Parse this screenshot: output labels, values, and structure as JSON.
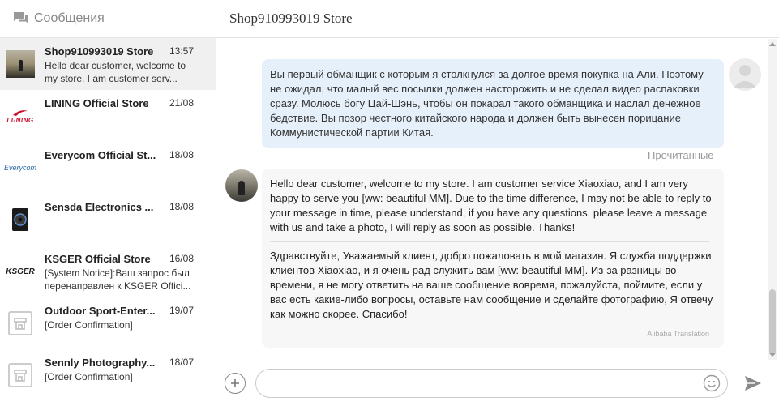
{
  "sidebar": {
    "title": "Сообщения",
    "conversations": [
      {
        "name": "Shop910993019 Store",
        "date": "13:57",
        "preview": "Hello dear customer, welcome to my store. I am customer serv...",
        "logo": "photo-avatar"
      },
      {
        "name": "LINING Official Store",
        "date": "21/08",
        "preview": "",
        "logo_text": "LI-NING"
      },
      {
        "name": "Everycom Official St...",
        "date": "18/08",
        "preview": "",
        "logo_text": "Everycom"
      },
      {
        "name": "Sensda Electronics ...",
        "date": "18/08",
        "preview": "",
        "logo": "device-photo"
      },
      {
        "name": "KSGER Official Store",
        "date": "16/08",
        "preview": "[System Notice]:Ваш запрос был перенаправлен к KSGER Offici...",
        "logo_text": "KSGER"
      },
      {
        "name": "Outdoor Sport-Enter...",
        "date": "19/07",
        "preview": "[Order Confirmation]",
        "logo": "store-icon"
      },
      {
        "name": "Sennly Photography...",
        "date": "18/07",
        "preview": "[Order Confirmation]",
        "logo": "store-icon"
      }
    ]
  },
  "header": {
    "store_title": "Shop910993019 Store"
  },
  "messages": {
    "mine": {
      "text": "Вы первый обманщик с которым я столкнулся за долгое время покупка на Али. Поэтому не ожидал, что малый вес посылки должен насторожить и не сделал видео распаковки сразу. Молюсь богу Цай-Шэнь, чтобы он покарал такого обманщика и наслал денежное бедствие. Вы позор честного китайского народа и должен быть вынесен порицание Коммунистической партии Китая.",
      "status": "Прочитанные"
    },
    "theirs": {
      "original": "Hello dear customer, welcome to my store. I am customer service Xiaoxiao, and I am very happy to serve you [ww: beautiful MM]. Due to the time difference, I may not be able to reply to your message in time, please understand, if you have any questions, please leave a message with us and take a photo, I will reply as soon as possible. Thanks!",
      "translation": "Здравствуйте, Уважаемый клиент, добро пожаловать в мой магазин. Я служба поддержки клиентов Xiaoxiao, и я очень рад служить вам [ww: beautiful MM]. Из-за разницы во времени, я не могу ответить на ваше сообщение вовремя, пожалуйста, поймите, если у вас есть какие-либо вопросы, оставьте нам сообщение и сделайте фотографию, Я отвечу как можно скорее. Спасибо!",
      "translation_credit": "Alibaba Translation"
    }
  },
  "input": {
    "placeholder": "",
    "value": ""
  },
  "colors": {
    "my_bubble": "#e6f0fb",
    "their_bubble": "#f7f7f7",
    "active_conv": "#f0f0f0",
    "lining_red": "#c8102e",
    "everycom_blue": "#2a6aa8"
  }
}
